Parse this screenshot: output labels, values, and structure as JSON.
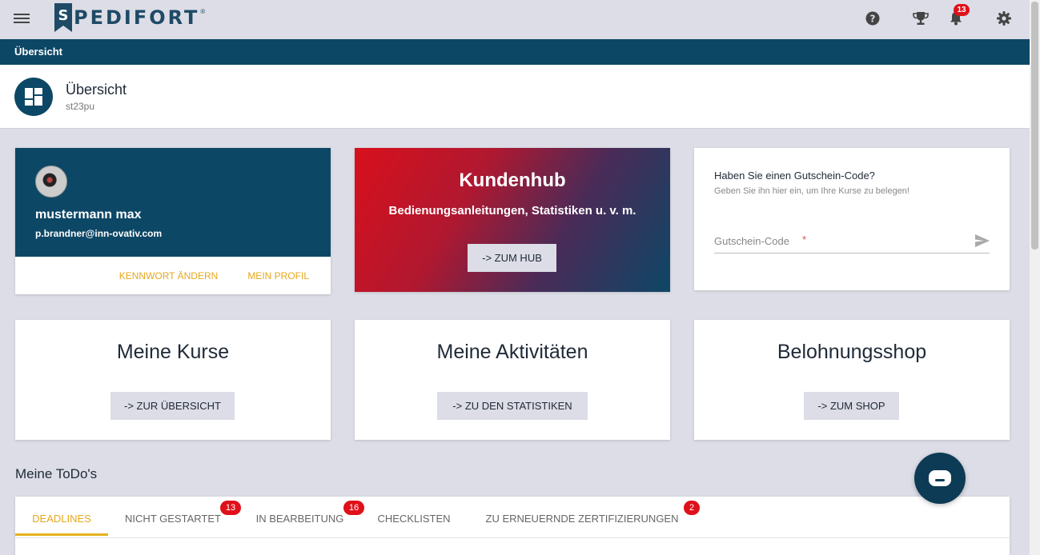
{
  "header": {
    "logo_text": "PEDIFORT",
    "logo_reg": "®",
    "notifications_count": "13",
    "icons": [
      "menu-icon",
      "help-icon",
      "trophy-icon",
      "bell-icon",
      "gear-icon"
    ]
  },
  "breadcrumb": {
    "label": "Übersicht"
  },
  "page": {
    "title": "Übersicht",
    "subtitle": "st23pu"
  },
  "profile": {
    "name": "mustermann max",
    "email": "p.brandner@inn-ovativ.com",
    "change_password": "KENNWORT ÄNDERN",
    "my_profile": "MEIN PROFIL"
  },
  "hub": {
    "title": "Kundenhub",
    "subtitle": "Bedienungsanleitungen, Statistiken u. v. m.",
    "button": "-> ZUM HUB"
  },
  "voucher": {
    "title": "Haben Sie einen Gutschein-Code?",
    "subtitle": "Geben Sie ihn hier ein, um Ihre Kurse zu belegen!",
    "placeholder": "Gutschein-Code",
    "required_mark": "*"
  },
  "tiles": [
    {
      "title": "Meine Kurse",
      "button": "-> ZUR ÜBERSICHT"
    },
    {
      "title": "Meine Aktivitäten",
      "button": "-> ZU DEN STATISTIKEN"
    },
    {
      "title": "Belohnungsshop",
      "button": "-> ZUM SHOP"
    }
  ],
  "todos": {
    "heading": "Meine ToDo's",
    "tabs": [
      {
        "label": "DEADLINES",
        "badge": ""
      },
      {
        "label": "NICHT GESTARTET",
        "badge": "13"
      },
      {
        "label": "IN BEARBEITUNG",
        "badge": "16"
      },
      {
        "label": "CHECKLISTEN",
        "badge": ""
      },
      {
        "label": "ZU ERNEUERNDE ZERTIFIZIERUNGEN",
        "badge": "2"
      }
    ]
  },
  "colors": {
    "primary": "#0d4766",
    "accent": "#e6a81c",
    "badge": "#e0101a",
    "background": "#dcdde6"
  }
}
